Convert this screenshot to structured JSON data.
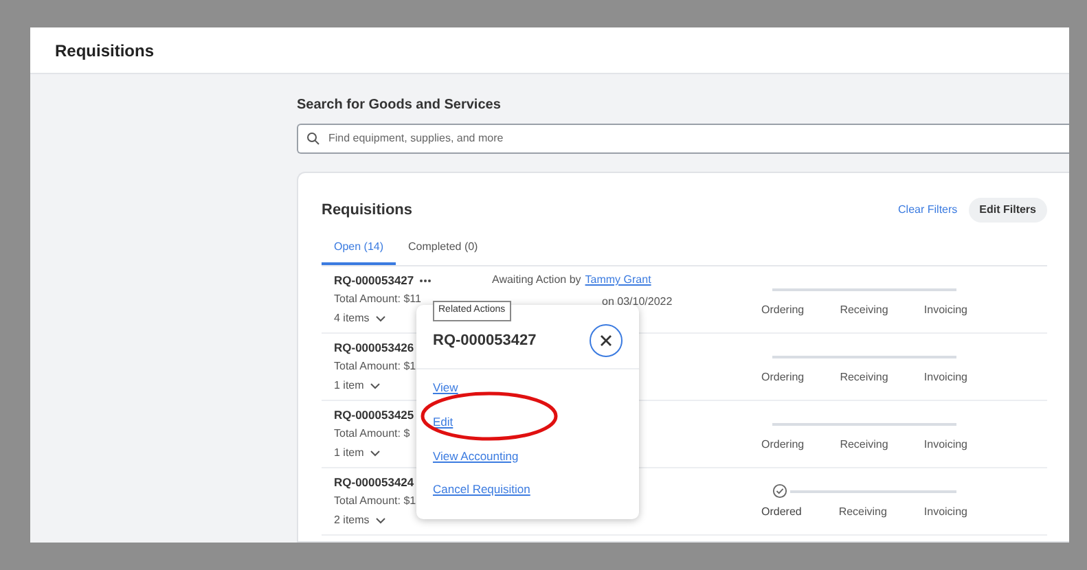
{
  "page_title": "Requisitions",
  "search": {
    "label": "Search for Goods and Services",
    "placeholder": "Find equipment, supplies, and more"
  },
  "card": {
    "title": "Requisitions",
    "clear_filters": "Clear Filters",
    "edit_filters": "Edit Filters",
    "tabs": [
      {
        "label": "Open (14)",
        "selected": true
      },
      {
        "label": "Completed (0)",
        "selected": false
      }
    ],
    "rows": [
      {
        "id": "RQ-000053427",
        "more": true,
        "amount": "Total Amount: $11",
        "items": "4 items",
        "status": {
          "prefix": "Awaiting Action by",
          "person": "Tammy Grant",
          "date": "on 03/10/2022"
        },
        "steps": [
          {
            "label": "Ordering",
            "done": false
          },
          {
            "label": "Receiving",
            "done": false
          },
          {
            "label": "Invoicing",
            "done": false
          }
        ]
      },
      {
        "id": "RQ-000053426",
        "more": false,
        "amount": "Total Amount: $1",
        "items": "1 item",
        "steps": [
          {
            "label": "Ordering",
            "done": false
          },
          {
            "label": "Receiving",
            "done": false
          },
          {
            "label": "Invoicing",
            "done": false
          }
        ]
      },
      {
        "id": "RQ-000053425",
        "more": false,
        "amount": "Total Amount: $",
        "items": "1 item",
        "steps": [
          {
            "label": "Ordering",
            "done": false
          },
          {
            "label": "Receiving",
            "done": false
          },
          {
            "label": "Invoicing",
            "done": false
          }
        ]
      },
      {
        "id": "RQ-000053424",
        "more": false,
        "amount": "Total Amount: $1",
        "items": "2 items",
        "steps": [
          {
            "label": "Ordered",
            "done": true
          },
          {
            "label": "Receiving",
            "done": false
          },
          {
            "label": "Invoicing",
            "done": false
          }
        ]
      }
    ]
  },
  "popover": {
    "tooltip": "Related Actions",
    "title": "RQ-000053427",
    "actions": [
      "View",
      "Edit",
      "View Accounting",
      "Cancel Requisition"
    ]
  }
}
